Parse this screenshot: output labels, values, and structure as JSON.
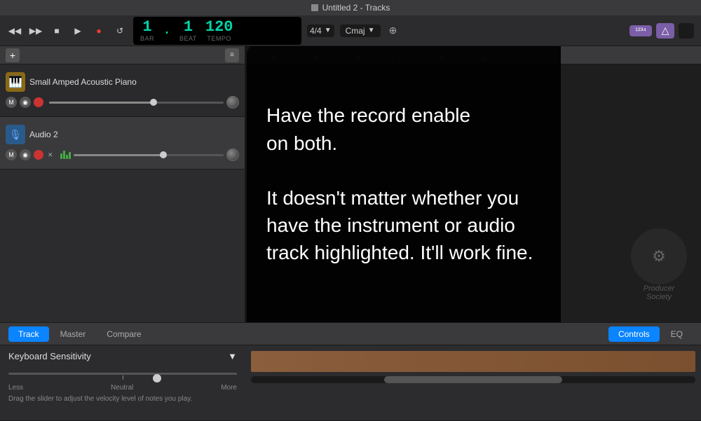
{
  "window": {
    "title": "Untitled 2 - Tracks",
    "icon_label": "doc-icon"
  },
  "transport": {
    "rewind_label": "⏮",
    "forward_label": "⏭",
    "stop_label": "■",
    "play_label": "▶",
    "record_label": "●",
    "loop_label": "↺",
    "bar": "1",
    "beat": "1",
    "tempo": "120",
    "time_sig": "4/4",
    "key": "Cmaj",
    "bar_label": "BAR",
    "beat_label": "BEAT",
    "tempo_label": "TEMPO",
    "smart_controls_label": "¹²³⁴",
    "library_label": "△"
  },
  "tracks": [
    {
      "id": "track-1",
      "name": "Small Amped Acoustic Piano",
      "type": "instrument",
      "icon_type": "piano",
      "icon_emoji": "🎹",
      "selected": false
    },
    {
      "id": "track-2",
      "name": "Audio 2",
      "type": "audio",
      "icon_type": "audio",
      "icon_text": "♫",
      "selected": true
    }
  ],
  "ruler": {
    "marks": [
      "1",
      "3",
      "5",
      "7",
      "9",
      "11",
      "13"
    ]
  },
  "tooltip": {
    "line1": "Have the record enable on",
    "line2": "both.",
    "line3": "",
    "line4": "It doesn't matter whether you",
    "line5": "have the instrument or audio",
    "line6": "track highlighted. It'll work fine."
  },
  "bottom_panel": {
    "tabs_left": [
      {
        "label": "Track",
        "active": true
      },
      {
        "label": "Master",
        "active": false
      },
      {
        "label": "Compare",
        "active": false
      }
    ],
    "tabs_right": [
      {
        "label": "Controls",
        "active": true
      },
      {
        "label": "EQ",
        "active": false
      }
    ],
    "section_label": "Keyboard Sensitivity",
    "slider_labels": {
      "less": "Less",
      "neutral": "Neutral",
      "more": "More"
    },
    "description": "Drag the slider to adjust the velocity level of notes you play."
  }
}
